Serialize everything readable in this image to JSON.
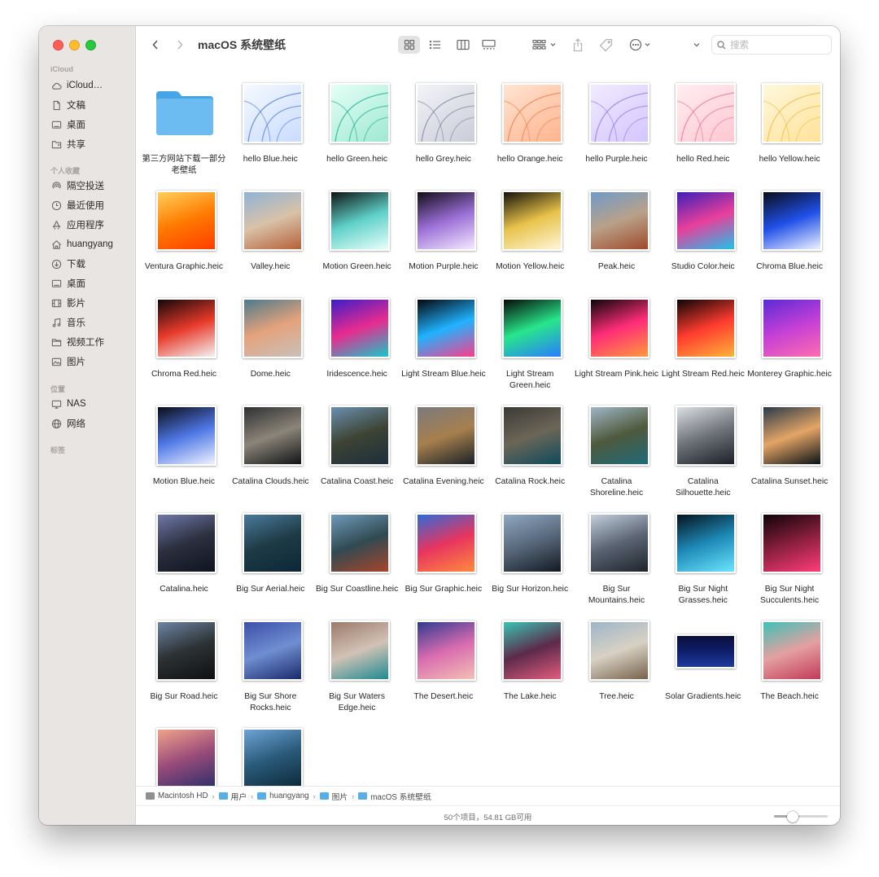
{
  "window": {
    "title": "macOS 系统壁纸"
  },
  "sidebar": {
    "sections": [
      {
        "label": "iCloud",
        "items": [
          {
            "label": "iCloud…",
            "icon": "cloud-icon"
          },
          {
            "label": "文稿",
            "icon": "document-icon"
          },
          {
            "label": "桌面",
            "icon": "desktop-icon"
          },
          {
            "label": "共享",
            "icon": "shared-folder-icon"
          }
        ]
      },
      {
        "label": "个人收藏",
        "items": [
          {
            "label": "隔空投送",
            "icon": "airdrop-icon"
          },
          {
            "label": "最近使用",
            "icon": "clock-icon"
          },
          {
            "label": "应用程序",
            "icon": "applications-icon"
          },
          {
            "label": "huangyang",
            "icon": "home-icon"
          },
          {
            "label": "下载",
            "icon": "download-icon"
          },
          {
            "label": "桌面",
            "icon": "desktop-icon"
          },
          {
            "label": "影片",
            "icon": "film-icon"
          },
          {
            "label": "音乐",
            "icon": "music-icon"
          },
          {
            "label": "视频工作",
            "icon": "folder-icon"
          },
          {
            "label": "图片",
            "icon": "photo-icon"
          }
        ]
      },
      {
        "label": "位置",
        "items": [
          {
            "label": "NAS",
            "icon": "display-icon"
          },
          {
            "label": "网络",
            "icon": "network-icon"
          }
        ]
      },
      {
        "label": "标签",
        "items": []
      }
    ]
  },
  "search": {
    "placeholder": "搜索"
  },
  "files": [
    {
      "name": "第三方网站下载一部分老壁纸",
      "kind": "folder"
    },
    {
      "name": "hello Blue.heic",
      "colors": [
        "#f5f9ff",
        "#c9dcff"
      ],
      "stroke": "#5b86e6"
    },
    {
      "name": "hello Green.heic",
      "colors": [
        "#e5fff5",
        "#9ee8d2"
      ],
      "stroke": "#2fb89a"
    },
    {
      "name": "hello Grey.heic",
      "colors": [
        "#f3f4f8",
        "#c9ccd8"
      ],
      "stroke": "#8c91a8"
    },
    {
      "name": "hello Orange.heic",
      "colors": [
        "#ffe4d2",
        "#ffb48e"
      ],
      "stroke": "#f0855a"
    },
    {
      "name": "hello Purple.heic",
      "colors": [
        "#f1ebff",
        "#d4c5ff"
      ],
      "stroke": "#9b83ee"
    },
    {
      "name": "hello Red.heic",
      "colors": [
        "#ffeef1",
        "#ffc7d1"
      ],
      "stroke": "#ef7f95"
    },
    {
      "name": "hello Yellow.heic",
      "colors": [
        "#fff8dc",
        "#ffe29a"
      ],
      "stroke": "#f2c14e"
    },
    {
      "name": "Ventura Graphic.heic",
      "colors": [
        "#ffcf5a",
        "#ff7a00",
        "#ff3d00"
      ]
    },
    {
      "name": "Valley.heic",
      "colors": [
        "#8fb3d6",
        "#d9c2a8",
        "#b5603a"
      ]
    },
    {
      "name": "Motion Green.heic",
      "colors": [
        "#0d1414",
        "#5fd1c8",
        "#e8fffb"
      ]
    },
    {
      "name": "Motion Purple.heic",
      "colors": [
        "#120d19",
        "#9b6fd6",
        "#f3e9ff"
      ]
    },
    {
      "name": "Motion Yellow.heic",
      "colors": [
        "#15120a",
        "#e8c24a",
        "#fff6d8"
      ]
    },
    {
      "name": "Peak.heic",
      "colors": [
        "#6f9bc9",
        "#b9a189",
        "#9f4a2a"
      ]
    },
    {
      "name": "Studio Color.heic",
      "colors": [
        "#3b1fb8",
        "#e93f9b",
        "#1fc2e8"
      ]
    },
    {
      "name": "Chroma Blue.heic",
      "colors": [
        "#0a0c18",
        "#2050e8",
        "#eef3ff"
      ]
    },
    {
      "name": "Chroma Red.heic",
      "colors": [
        "#130809",
        "#e83a2a",
        "#f3f3f3"
      ]
    },
    {
      "name": "Dome.heic",
      "colors": [
        "#4d7a8c",
        "#e5a27c",
        "#c8c1bb"
      ]
    },
    {
      "name": "Iridescence.heic",
      "colors": [
        "#3a1ec8",
        "#e82b8f",
        "#15c9c9"
      ]
    },
    {
      "name": "Light Stream Blue.heic",
      "colors": [
        "#06060c",
        "#1fb3ff",
        "#ff3c8a"
      ]
    },
    {
      "name": "Light Stream Green.heic",
      "colors": [
        "#060b08",
        "#27e68a",
        "#2a7cff"
      ]
    },
    {
      "name": "Light Stream Pink.heic",
      "colors": [
        "#0b0508",
        "#ff2d78",
        "#ff9a3c"
      ]
    },
    {
      "name": "Light Stream Red.heic",
      "colors": [
        "#0b0505",
        "#ff3b2f",
        "#ffb23a"
      ]
    },
    {
      "name": "Monterey Graphic.heic",
      "colors": [
        "#5b2bd6",
        "#c43fd6",
        "#ff6db0"
      ]
    },
    {
      "name": "Motion Blue.heic",
      "colors": [
        "#0a0c16",
        "#4f78e6",
        "#eef2ff"
      ]
    },
    {
      "name": "Catalina Clouds.heic",
      "colors": [
        "#2f3032",
        "#8b8579",
        "#121416"
      ]
    },
    {
      "name": "Catalina Coast.heic",
      "colors": [
        "#6b8fb0",
        "#3d4434",
        "#1d2e3d"
      ]
    },
    {
      "name": "Catalina Evening.heic",
      "colors": [
        "#7b7a7e",
        "#a77f4d",
        "#1b2228"
      ]
    },
    {
      "name": "Catalina Rock.heic",
      "colors": [
        "#3a3a36",
        "#6c6657",
        "#0e4a5c"
      ]
    },
    {
      "name": "Catalina Shoreline.heic",
      "colors": [
        "#9fb6c7",
        "#4f5a3c",
        "#1e6a7a"
      ]
    },
    {
      "name": "Catalina Silhouette.heic",
      "colors": [
        "#dcdfe2",
        "#6f737a",
        "#1c2026"
      ]
    },
    {
      "name": "Catalina Sunset.heic",
      "colors": [
        "#2a3a4a",
        "#e4a566",
        "#0b1216"
      ]
    },
    {
      "name": "Catalina.heic",
      "colors": [
        "#6f78a8",
        "#2b2f3e",
        "#0f1420"
      ]
    },
    {
      "name": "Big Sur Aerial.heic",
      "colors": [
        "#4a7a9c",
        "#1e3a44",
        "#0c2838"
      ]
    },
    {
      "name": "Big Sur Coastline.heic",
      "colors": [
        "#6f9ab9",
        "#304a52",
        "#a8452a"
      ]
    },
    {
      "name": "Big Sur Graphic.heic",
      "colors": [
        "#2e6bd8",
        "#e8345f",
        "#ff8a3d"
      ]
    },
    {
      "name": "Big Sur Horizon.heic",
      "colors": [
        "#8fa8c2",
        "#57677a",
        "#121a22"
      ]
    },
    {
      "name": "Big Sur Mountains.heic",
      "colors": [
        "#c3cfdb",
        "#5a6473",
        "#1e242b"
      ]
    },
    {
      "name": "Big Sur Night Grasses.heic",
      "colors": [
        "#06121c",
        "#1e8ab8",
        "#6be5ff"
      ]
    },
    {
      "name": "Big Sur Night Succulents.heic",
      "colors": [
        "#0e0408",
        "#8a1f3e",
        "#ff3d7a"
      ]
    },
    {
      "name": "Big Sur Road.heic",
      "colors": [
        "#6d85a3",
        "#2c3133",
        "#0e1012"
      ]
    },
    {
      "name": "Big Sur Shore Rocks.heic",
      "colors": [
        "#3d4fa8",
        "#6f8ed1",
        "#1a2a6a"
      ]
    },
    {
      "name": "Big Sur Waters Edge.heic",
      "colors": [
        "#9a7a6a",
        "#d2c2b6",
        "#1e8a92"
      ]
    },
    {
      "name": "The Desert.heic",
      "colors": [
        "#2f3b8f",
        "#d96bb0",
        "#f3c1b3"
      ]
    },
    {
      "name": "The Lake.heic",
      "colors": [
        "#3ac4b2",
        "#5c2a4a",
        "#e25c7e"
      ]
    },
    {
      "name": "Tree.heic",
      "colors": [
        "#9db5c9",
        "#d8d1c4",
        "#76624a"
      ]
    },
    {
      "name": "Solar Gradients.heic",
      "colors": [
        "#0a0f3a",
        "#101e6b",
        "#1d3d9c"
      ],
      "kind": "wide"
    },
    {
      "name": "The Beach.heic",
      "colors": [
        "#3ec2b8",
        "#e4a0a0",
        "#c23a5a"
      ]
    },
    {
      "name": "",
      "colors": [
        "#f0a38a",
        "#9a4c7a",
        "#2f2f6a"
      ]
    },
    {
      "name": "",
      "colors": [
        "#6ea3d6",
        "#2a5a7a",
        "#0d2a3a"
      ]
    }
  ],
  "pathbar": [
    "Macintosh HD",
    "用户",
    "huangyang",
    "图片",
    "macOS 系统壁纸"
  ],
  "status": {
    "text": "50个项目，54.81 GB可用",
    "zoom": 0.35
  }
}
